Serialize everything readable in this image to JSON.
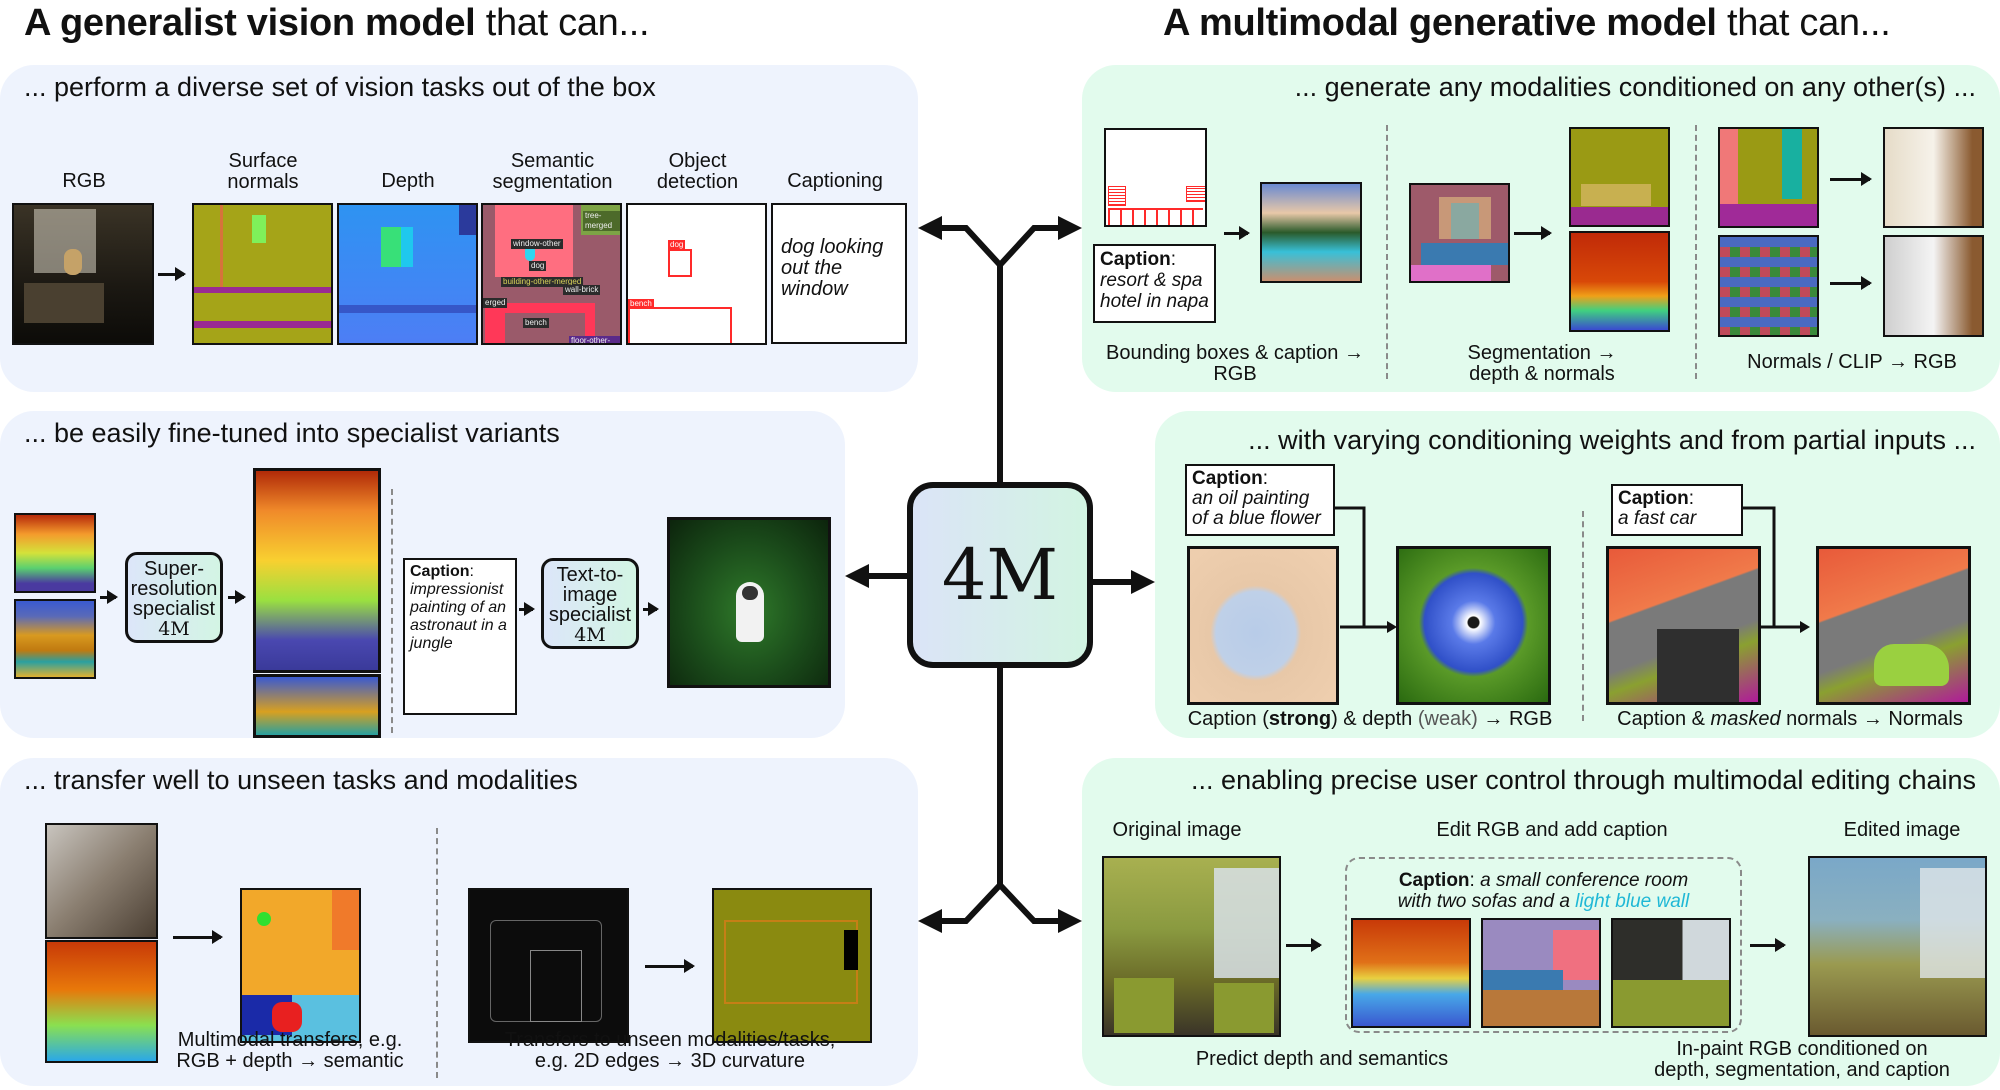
{
  "titles": {
    "left_bold": "A generalist vision model",
    "left_rest": " that can...",
    "right_bold": "A multimodal generative model",
    "right_rest": " that can..."
  },
  "center": {
    "label": "4M"
  },
  "colors": {
    "left_panel_bg": "#eef3fd",
    "right_panel_bg": "#e2fbed",
    "highlight_text": "#1fb8d6",
    "detection_red": "#ff2a2a"
  },
  "left_panels": [
    {
      "title": "... perform a diverse set of vision tasks out of the box",
      "columns": [
        {
          "label": "RGB"
        },
        {
          "label": "Surface\nnormals"
        },
        {
          "label": "Depth"
        },
        {
          "label": "Semantic\nsegmentation"
        },
        {
          "label": "Object\ndetection"
        },
        {
          "label": "Captioning"
        }
      ],
      "seg_tags": [
        "tree-merged",
        "window-other",
        "dog",
        "building-other-merged",
        "wall-brick",
        "erged",
        "bench",
        "floor-other-mer"
      ],
      "det_tags": [
        "dog",
        "bench"
      ],
      "caption_text": "dog looking out the window"
    },
    {
      "title": "... be easily fine-tuned into specialist variants",
      "sr_specialist": {
        "line1": "Super-",
        "line2": "resolution",
        "line3": "specialist",
        "model": "4M"
      },
      "caption_box": {
        "key": "Caption",
        "text": "impressionist painting of an astronaut in a jungle"
      },
      "t2i_specialist": {
        "line1": "Text-to-",
        "line2": "image",
        "line3": "specialist",
        "model": "4M"
      }
    },
    {
      "title": "... transfer well to unseen tasks and modalities",
      "caption_left_1": "Multimodal transfers, e.g.",
      "caption_left_2": "RGB + depth → semantic",
      "caption_right_1": "Transfers to unseen modalities/tasks,",
      "caption_right_2": "e.g. 2D edges → 3D curvature"
    }
  ],
  "right_panels": [
    {
      "title": "... generate any modalities conditioned on any other(s) ...",
      "caption_box": {
        "key": "Caption",
        "text_1": "resort & spa",
        "text_2": "hotel in napa"
      },
      "label_1a": "Bounding boxes & caption →",
      "label_1b": "RGB",
      "label_2a": "Segmentation →",
      "label_2b": "depth & normals",
      "label_3": "Normals / CLIP → RGB"
    },
    {
      "title": "... with varying conditioning weights and from partial inputs ...",
      "caption_box_1": {
        "key": "Caption",
        "text_1": "an oil painting",
        "text_2": "of a blue flower"
      },
      "caption_box_2": {
        "key": "Caption",
        "text_1": "a fast car"
      },
      "label_1": {
        "pre": "Caption (",
        "bold": "strong",
        "mid": ") & depth ",
        "weak": "(weak)",
        "post": "  → RGB"
      },
      "label_2": {
        "pre": "Caption & ",
        "italic": "masked",
        "post": " normals → Normals"
      }
    },
    {
      "title": "... enabling precise user control through multimodal editing chains",
      "header_original": "Original image",
      "header_edit": "Edit RGB and add caption",
      "header_edited": "Edited image",
      "caption": {
        "key": "Caption",
        "text_1": "a small conference room",
        "text_2": "with two sofas and a ",
        "highlight": "light blue wall"
      },
      "footer_predict": "Predict depth and semantics",
      "footer_inpaint_1": "In-paint RGB conditioned on",
      "footer_inpaint_2": "depth, segmentation, and caption"
    }
  ]
}
